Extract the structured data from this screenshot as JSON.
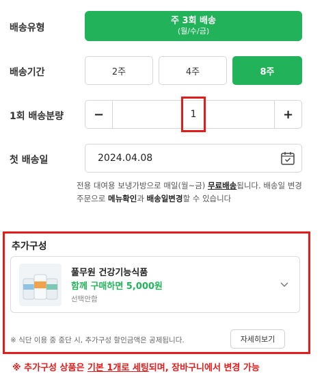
{
  "delivery_type": {
    "label": "배송유형",
    "option_line1": "주 3회 배송",
    "option_line2": "(월/수/금)"
  },
  "delivery_period": {
    "label": "배송기간",
    "options": [
      "2주",
      "4주",
      "8주"
    ],
    "selected": "8주"
  },
  "quantity": {
    "label": "1회 배송분량",
    "minus": "−",
    "value": "1",
    "plus": "+"
  },
  "first_delivery": {
    "label": "첫 배송일",
    "date": "2024.04.08",
    "icon": "calendar-icon"
  },
  "notice": {
    "part1": "전용 대여용 보냉가방으로 매일(월~금) ",
    "free_delivery": "무료배송",
    "part2": "됩니다. 배송일 변경 주문으로 ",
    "menu_check": "메뉴확인",
    "part3": "과 ",
    "date_change": "배송일변경",
    "part4": "할 수 있습니다"
  },
  "addon": {
    "title": "추가구성",
    "product_name": "풀무원 건강기능식품",
    "promo": "함께 구매하면 5,000원",
    "selection": "선택안함",
    "note": "※ 식단 이용 중 중단 시, 추가구성 할인금액은 공제됩니다.",
    "detail_button": "자세히보기"
  },
  "footer": {
    "prefix": "※ 추가구성 상품은 ",
    "underlined": "기본 1개로 세팅",
    "suffix": "되며, 장바구니에서 변경 가능"
  },
  "colors": {
    "accent": "#22b35a",
    "highlight": "#e21b1b"
  }
}
